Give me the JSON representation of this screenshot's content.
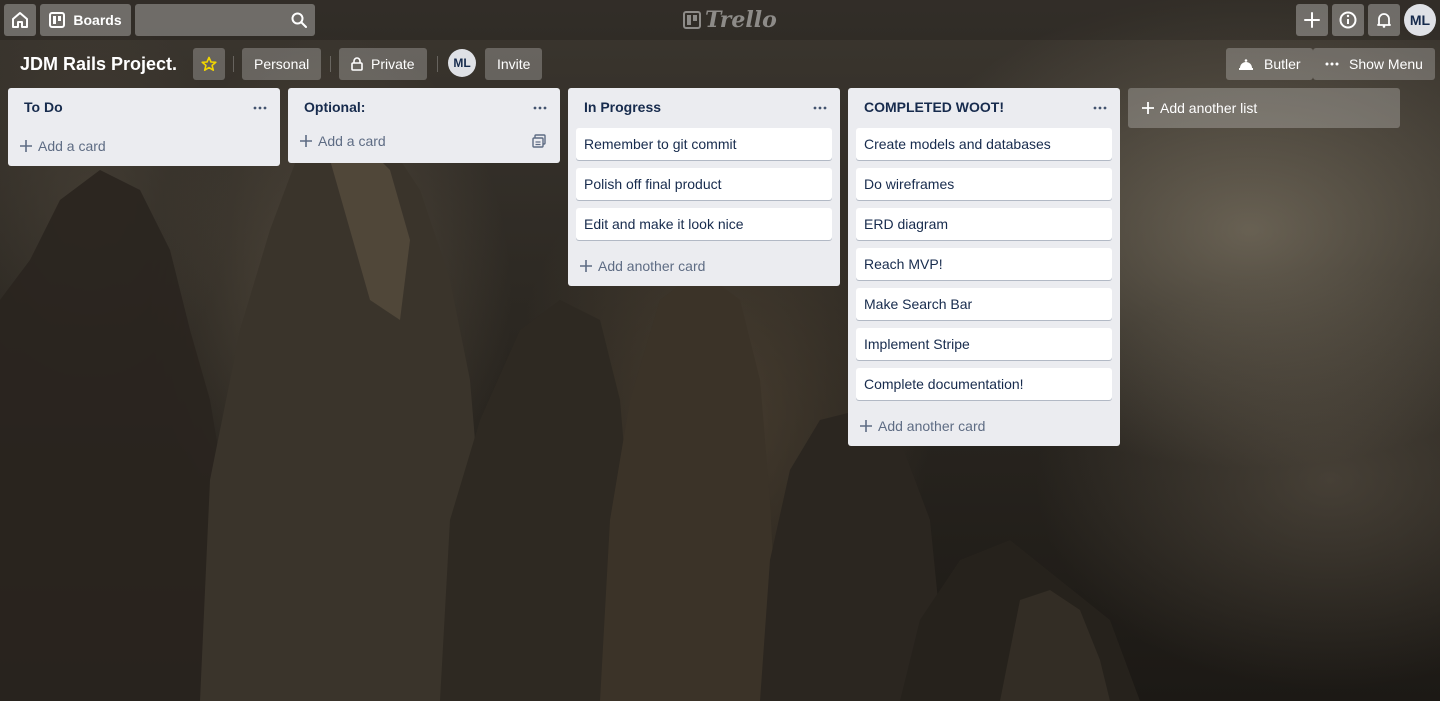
{
  "header": {
    "home_icon": "home-icon",
    "boards_label": "Boards",
    "search_value": "",
    "logo_text": "Trello",
    "avatar_initials": "ML"
  },
  "board": {
    "title": "JDM Rails Project.",
    "team_label": "Personal",
    "visibility_label": "Private",
    "member_initials": "ML",
    "invite_label": "Invite",
    "butler_label": "Butler",
    "show_menu_label": "Show Menu"
  },
  "lists": [
    {
      "title": "To Do",
      "cards": [],
      "add_label": "Add a card"
    },
    {
      "title": "Optional:",
      "cards": [],
      "add_label": "Add a card"
    },
    {
      "title": "In Progress",
      "cards": [
        "Remember to git commit",
        "Polish off final product",
        "Edit and make it look nice"
      ],
      "add_label": "Add another card"
    },
    {
      "title": "COMPLETED WOOT!",
      "cards": [
        "Create models and databases",
        "Do wireframes",
        "ERD diagram",
        "Reach MVP!",
        "Make Search Bar",
        "Implement Stripe",
        "Complete documentation!"
      ],
      "add_label": "Add another card"
    }
  ],
  "add_list_label": "Add another list",
  "colors": {
    "list_bg": "#ebecf0",
    "card_text": "#172b4d",
    "star": "#f2d600"
  }
}
